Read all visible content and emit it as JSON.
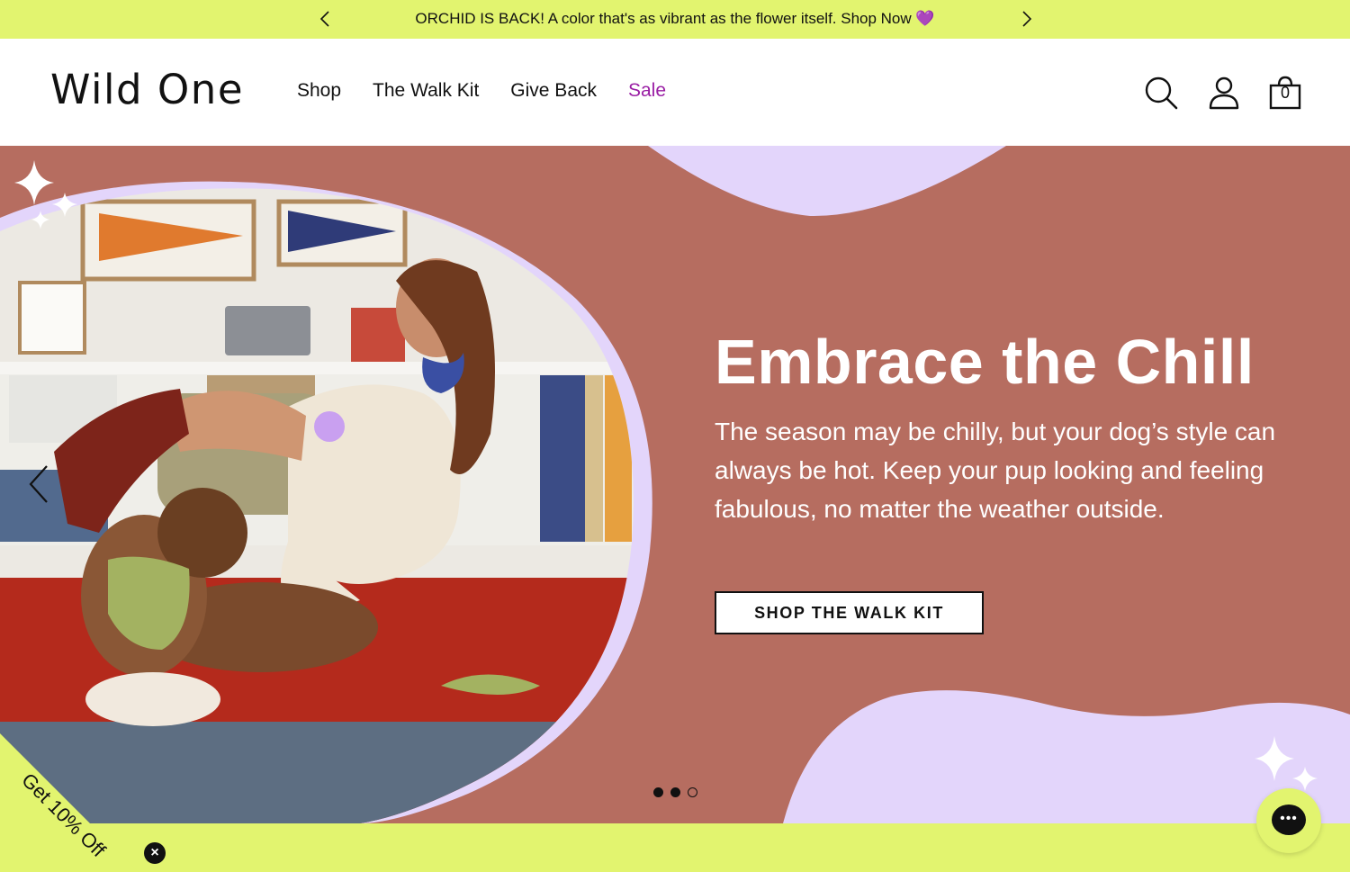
{
  "announcement": {
    "text": "ORCHID IS BACK! A color that's as vibrant as the flower itself. Shop Now 💜"
  },
  "header": {
    "logo": "Wild One",
    "nav": [
      {
        "label": "Shop"
      },
      {
        "label": "The Walk Kit"
      },
      {
        "label": "Give Back"
      },
      {
        "label": "Sale"
      }
    ],
    "cart_count": "0"
  },
  "hero": {
    "title": "Embrace the Chill",
    "body": "The season may be chilly, but your dog’s style can always be hot. Keep your pup looking and feeling fabulous, no matter the weather outside.",
    "cta": "SHOP THE WALK KIT",
    "slides_total": 3,
    "slide_active": 3
  },
  "promo": {
    "discount_label": "Get 10% Off"
  },
  "colors": {
    "accent_lime": "#e2f46f",
    "hero_bg": "#b66d60",
    "lavender": "#e3d5fb",
    "sale": "#9a1ea4"
  }
}
